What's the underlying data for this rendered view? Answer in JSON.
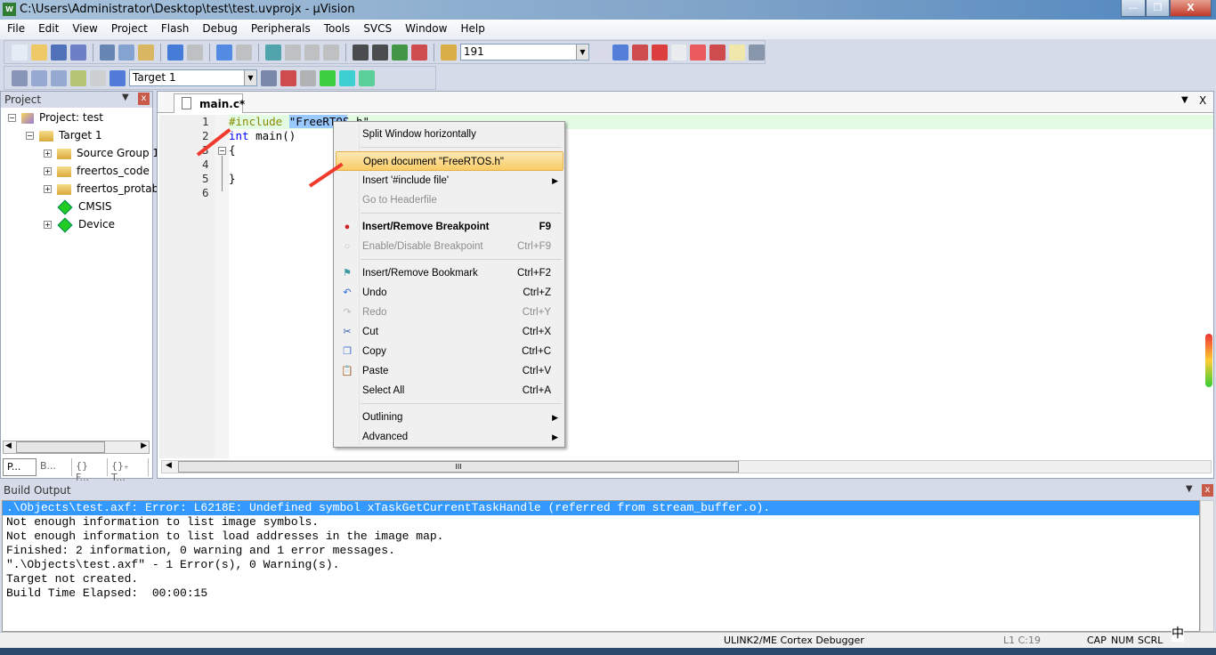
{
  "window": {
    "title": "C:\\Users\\Administrator\\Desktop\\test\\test.uvprojx - µVision",
    "logo": "W",
    "minimize": "—",
    "restore": "❐",
    "close": "X"
  },
  "menu": [
    "File",
    "Edit",
    "View",
    "Project",
    "Flash",
    "Debug",
    "Peripherals",
    "Tools",
    "SVCS",
    "Window",
    "Help"
  ],
  "toolbar1": {
    "icons": [
      "new-file",
      "open-file",
      "save",
      "save-all",
      "cut",
      "copy",
      "paste",
      "undo",
      "redo",
      "nav-back",
      "nav-forward",
      "bookmark",
      "prev-bookmark",
      "next-bookmark",
      "clear-bookmarks",
      "indent",
      "unindent",
      "comment",
      "uncomment",
      "find-in-files"
    ],
    "find_value": "191",
    "icons_right": [
      "find",
      "incremental-find",
      "debug-session",
      "breakpoint-insert",
      "breakpoint-enable",
      "breakpoint-disable-all",
      "breakpoint-kill-all",
      "window-layout",
      "configure"
    ]
  },
  "toolbar2": {
    "icons": [
      "translate",
      "build",
      "rebuild",
      "batch-build",
      "stop-build",
      "download"
    ],
    "target": "Target 1",
    "icons_right": [
      "target-options",
      "manage-project",
      "select-packs",
      "manage-runtime",
      "event-recorder",
      "pack-installer"
    ]
  },
  "project": {
    "title": "Project",
    "pin": "📌",
    "close": "x",
    "tree": [
      {
        "label": "Project: test",
        "level": 0,
        "expander": "−"
      },
      {
        "label": "Target 1",
        "level": 1,
        "expander": "−"
      },
      {
        "label": "Source Group 1",
        "level": 2,
        "expander": "+"
      },
      {
        "label": "freertos_code",
        "level": 2,
        "expander": "+"
      },
      {
        "label": "freertos_protab",
        "level": 2,
        "expander": "+"
      },
      {
        "label": "CMSIS",
        "level": 2,
        "expander": ""
      },
      {
        "label": "Device",
        "level": 2,
        "expander": "+"
      }
    ],
    "tabs": [
      "P...",
      "B...",
      "{} F...",
      "{}₊ T..."
    ]
  },
  "editor": {
    "tab": "main.c*",
    "dropdown": "▼",
    "close": "X",
    "lines": [
      {
        "n": "1",
        "parts": [
          {
            "t": "#include",
            "c": "#8a8a00"
          },
          {
            "t": " ",
            "c": "#000"
          },
          {
            "t": "\"FreeRTOS.h\"",
            "c": "#000"
          }
        ]
      },
      {
        "n": "2",
        "parts": [
          {
            "t": "int",
            "c": "#0000ff"
          },
          {
            "t": " main()",
            "c": "#000"
          }
        ]
      },
      {
        "n": "3",
        "parts": [
          {
            "t": "{",
            "c": "#000"
          }
        ]
      },
      {
        "n": "4",
        "parts": []
      },
      {
        "n": "5",
        "parts": [
          {
            "t": "}",
            "c": "#000"
          }
        ]
      },
      {
        "n": "6",
        "parts": []
      }
    ],
    "hscroll_grip": "III"
  },
  "context_menu": [
    {
      "label": "Split Window horizontally",
      "shortcut": "",
      "state": "normal"
    },
    {
      "sep": true
    },
    {
      "label": "Open document \"FreeRTOS.h\"",
      "shortcut": "",
      "state": "highlighted"
    },
    {
      "label": "Insert '#include file'",
      "shortcut": "",
      "state": "normal",
      "submenu": true
    },
    {
      "label": "Go to Headerfile",
      "shortcut": "",
      "state": "disabled"
    },
    {
      "sep": true
    },
    {
      "label": "Insert/Remove Breakpoint",
      "shortcut": "F9",
      "state": "bold",
      "icon": "breakpoint-icon"
    },
    {
      "label": "Enable/Disable Breakpoint",
      "shortcut": "Ctrl+F9",
      "state": "disabled",
      "icon": "breakpoint-disabled-icon"
    },
    {
      "sep": true
    },
    {
      "label": "Insert/Remove Bookmark",
      "shortcut": "Ctrl+F2",
      "state": "normal",
      "icon": "bookmark-icon"
    },
    {
      "label": "Undo",
      "shortcut": "Ctrl+Z",
      "state": "normal",
      "icon": "undo-icon"
    },
    {
      "label": "Redo",
      "shortcut": "Ctrl+Y",
      "state": "disabled",
      "icon": "redo-icon"
    },
    {
      "label": "Cut",
      "shortcut": "Ctrl+X",
      "state": "normal",
      "icon": "cut-icon"
    },
    {
      "label": "Copy",
      "shortcut": "Ctrl+C",
      "state": "normal",
      "icon": "copy-icon"
    },
    {
      "label": "Paste",
      "shortcut": "Ctrl+V",
      "state": "normal",
      "icon": "paste-icon"
    },
    {
      "label": "Select All",
      "shortcut": "Ctrl+A",
      "state": "normal"
    },
    {
      "sep": true
    },
    {
      "label": "Outlining",
      "shortcut": "",
      "state": "normal",
      "submenu": true
    },
    {
      "label": "Advanced",
      "shortcut": "",
      "state": "normal",
      "submenu": true
    }
  ],
  "build_output": {
    "title": "Build Output",
    "lines": [
      ".\\Objects\\test.axf: Error: L6218E: Undefined symbol xTaskGetCurrentTaskHandle (referred from stream_buffer.o).",
      "Not enough information to list image symbols.",
      "Not enough information to list load addresses in the image map.",
      "Finished: 2 information, 0 warning and 1 error messages.",
      "\".\\Objects\\test.axf\" - 1 Error(s), 0 Warning(s).",
      "Target not created.",
      "Build Time Elapsed:  00:00:15"
    ]
  },
  "status": {
    "debugger": "ULINK2/ME Cortex Debugger",
    "position": "L1 C:19",
    "cap": "CAP",
    "num": "NUM",
    "scrl": "SCRL",
    "ime": "中"
  },
  "colors": {
    "selection": "#3399ff",
    "current_line": "#e2fbe2",
    "menu_highlight": "#f9cc66",
    "annotation_arrow": "#f03a2e",
    "toolbar_bg": "#d6dbe9"
  }
}
